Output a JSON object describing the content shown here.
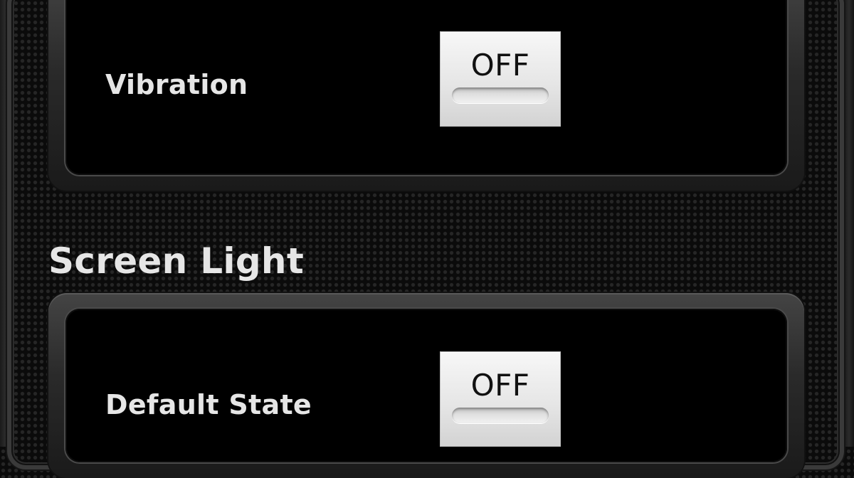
{
  "vibration": {
    "label": "Vibration",
    "toggle_state": "OFF"
  },
  "screen_light": {
    "title": "Screen Light",
    "default_state": {
      "label": "Default State",
      "toggle_state": "OFF"
    }
  }
}
